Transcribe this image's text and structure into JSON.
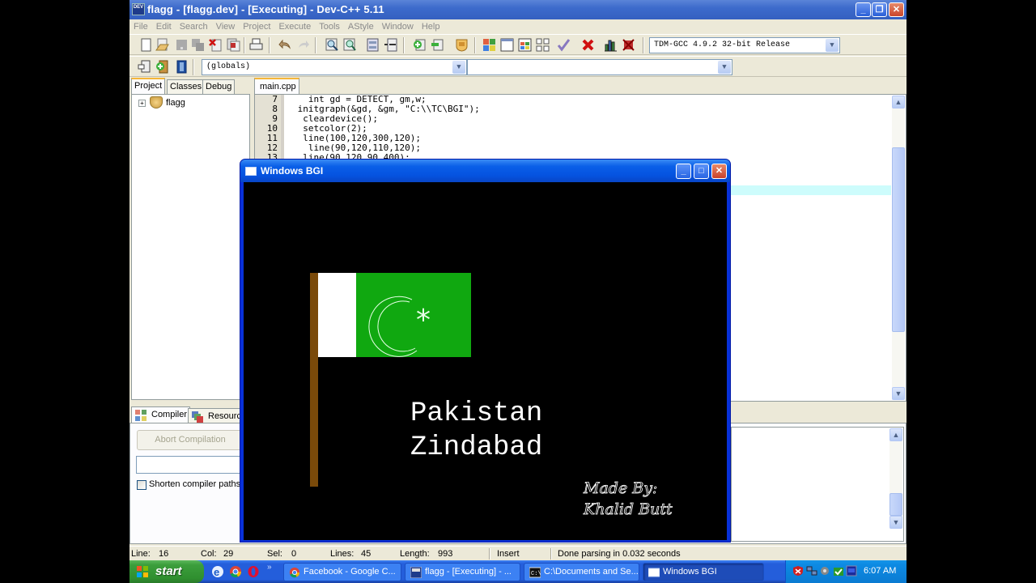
{
  "window": {
    "title": "flagg - [flagg.dev] - [Executing] - Dev-C++ 5.11",
    "app_icon_label": "DEV",
    "minimize": "_",
    "restore": "❐",
    "close": "✕"
  },
  "menu": [
    "File",
    "Edit",
    "Search",
    "View",
    "Project",
    "Execute",
    "Tools",
    "AStyle",
    "Window",
    "Help"
  ],
  "toolbar": {
    "compiler_select": "TDM-GCC 4.9.2 32-bit Release",
    "scope_select": "(globals)",
    "function_select": "",
    "icons": [
      "new-file-icon",
      "open-icon",
      "save-icon",
      "save-all-icon",
      "close-icon",
      "close-all-icon",
      "print-icon",
      "undo-icon",
      "redo-icon",
      "find-icon",
      "replace-icon",
      "indent-icon",
      "unindent-icon",
      "add-to-project-icon",
      "remove-from-project-icon",
      "project-options-icon",
      "compile-icon",
      "run-icon",
      "compile-run-icon",
      "rebuild-icon",
      "syntax-check-icon",
      "stop-execution-icon",
      "profile-icon",
      "delete-profile-icon"
    ]
  },
  "left_panel": {
    "tabs": [
      "Project",
      "Classes",
      "Debug"
    ],
    "active_tab": "Project",
    "tree": [
      {
        "label": "flagg",
        "expander": "+"
      }
    ]
  },
  "editor": {
    "tab": "main.cpp",
    "line_numbers": [
      "7",
      "8",
      "9",
      "10",
      "11",
      "12",
      "13"
    ],
    "lines": [
      "   int gd = DETECT, gm,w;",
      " initgraph(&gd, &gm, \"C:\\\\TC\\BGI\");",
      "  cleardevice();",
      "  setcolor(2);",
      "  line(100,120,300,120);",
      "   line(90,120,110,120);",
      "  line(90,120,90,400);"
    ]
  },
  "bottom_panel": {
    "tabs": [
      "Compiler",
      "Resources"
    ],
    "abort_button": "Abort Compilation",
    "command_input": "",
    "shorten_paths_label": "Shorten compiler paths",
    "shorten_paths_checked": false
  },
  "status": {
    "line_label": "Line:",
    "line": "16",
    "col_label": "Col:",
    "col": "29",
    "sel_label": "Sel:",
    "sel": "0",
    "lines_label": "Lines:",
    "lines": "45",
    "length_label": "Length:",
    "length": "993",
    "mode": "Insert",
    "message": "Done parsing in 0.032 seconds"
  },
  "bgi_window": {
    "title": "Windows BGI",
    "minimize": "_",
    "maximize": "□",
    "close": "✕",
    "flag_colors": {
      "pole": "#7a4a0a",
      "white": "#ffffff",
      "green": "#10a810",
      "emblem": "#e8ffe8"
    },
    "text_line1": "Pakistan",
    "text_line2": "Zindabad",
    "credit_line1": "Made By:",
    "credit_line2": "Khalid Butt"
  },
  "taskbar": {
    "start": "start",
    "quick_launch": [
      "ie-icon",
      "chrome-icon",
      "opera-icon"
    ],
    "overflow": "»",
    "buttons": [
      {
        "label": "Facebook - Google C...",
        "icon": "chrome-icon"
      },
      {
        "label": "flagg - [Executing] - ...",
        "icon": "devcpp-icon"
      },
      {
        "label": "C:\\Documents and Se...",
        "icon": "console-icon"
      },
      {
        "label": "Windows BGI",
        "icon": "window-icon"
      }
    ],
    "clock": "6:07 AM"
  }
}
